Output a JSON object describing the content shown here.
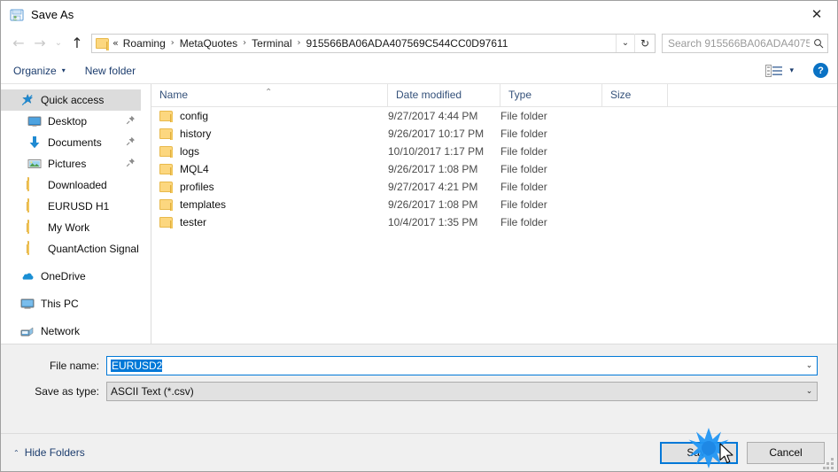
{
  "window": {
    "title": "Save As",
    "title_icon": "save-as-icon",
    "close_label": "✕"
  },
  "nav": {
    "back_icon": "←",
    "forward_icon": "→",
    "recent_icon": "⌄",
    "up_icon": "↑",
    "address_prefix": "«",
    "breadcrumbs": [
      "Roaming",
      "MetaQuotes",
      "Terminal",
      "915566BA06ADA407569C544CC0D97611"
    ],
    "separator": "›",
    "dropdown_icon": "⌄",
    "refresh_icon": "↻",
    "search_placeholder": "Search 915566BA06ADA40756...",
    "search_icon": "⚲"
  },
  "toolbar": {
    "organize_label": "Organize",
    "organize_caret": "▾",
    "new_folder_label": "New folder",
    "view_caret": "▾",
    "help_label": "?"
  },
  "sidebar": {
    "items": [
      {
        "label": "Quick access",
        "icon": "star-pin-icon",
        "selected": true,
        "pinned": false,
        "indent": false,
        "gap": false
      },
      {
        "label": "Desktop",
        "icon": "desktop-icon",
        "selected": false,
        "pinned": true,
        "indent": true,
        "gap": false
      },
      {
        "label": "Documents",
        "icon": "documents-icon",
        "selected": false,
        "pinned": true,
        "indent": true,
        "gap": false
      },
      {
        "label": "Pictures",
        "icon": "pictures-icon",
        "selected": false,
        "pinned": true,
        "indent": true,
        "gap": false
      },
      {
        "label": "Downloaded",
        "icon": "folder-icon",
        "selected": false,
        "pinned": false,
        "indent": true,
        "gap": false
      },
      {
        "label": "EURUSD H1",
        "icon": "folder-icon",
        "selected": false,
        "pinned": false,
        "indent": true,
        "gap": false
      },
      {
        "label": "My Work",
        "icon": "folder-icon",
        "selected": false,
        "pinned": false,
        "indent": true,
        "gap": false
      },
      {
        "label": "QuantAction Signal",
        "icon": "folder-icon",
        "selected": false,
        "pinned": false,
        "indent": true,
        "gap": false
      },
      {
        "label": "OneDrive",
        "icon": "onedrive-icon",
        "selected": false,
        "pinned": false,
        "indent": false,
        "gap": true
      },
      {
        "label": "This PC",
        "icon": "this-pc-icon",
        "selected": false,
        "pinned": false,
        "indent": false,
        "gap": true
      },
      {
        "label": "Network",
        "icon": "network-icon",
        "selected": false,
        "pinned": false,
        "indent": false,
        "gap": true
      }
    ],
    "pin_glyph": "📌"
  },
  "filelist": {
    "columns": [
      "Name",
      "Date modified",
      "Type",
      "Size"
    ],
    "sort_caret": "⌃",
    "rows": [
      {
        "name": "config",
        "date": "9/27/2017 4:44 PM",
        "type": "File folder",
        "size": ""
      },
      {
        "name": "history",
        "date": "9/26/2017 10:17 PM",
        "type": "File folder",
        "size": ""
      },
      {
        "name": "logs",
        "date": "10/10/2017 1:17 PM",
        "type": "File folder",
        "size": ""
      },
      {
        "name": "MQL4",
        "date": "9/26/2017 1:08 PM",
        "type": "File folder",
        "size": ""
      },
      {
        "name": "profiles",
        "date": "9/27/2017 4:21 PM",
        "type": "File folder",
        "size": ""
      },
      {
        "name": "templates",
        "date": "9/26/2017 1:08 PM",
        "type": "File folder",
        "size": ""
      },
      {
        "name": "tester",
        "date": "10/4/2017 1:35 PM",
        "type": "File folder",
        "size": ""
      }
    ]
  },
  "form": {
    "filename_label": "File name:",
    "filename_value": "EURUSD2",
    "filetype_label": "Save as type:",
    "filetype_value": "ASCII Text (*.csv)",
    "combo_arrow": "⌄"
  },
  "footer": {
    "hide_folders_caret": "⌃",
    "hide_folders_label": "Hide Folders",
    "save_label": "Save",
    "cancel_label": "Cancel"
  },
  "colors": {
    "accent": "#0078d7",
    "folder": "#fcd77f",
    "link_text": "#1c3d6e",
    "panel": "#f0f0f0",
    "selection": "#0078d7"
  }
}
